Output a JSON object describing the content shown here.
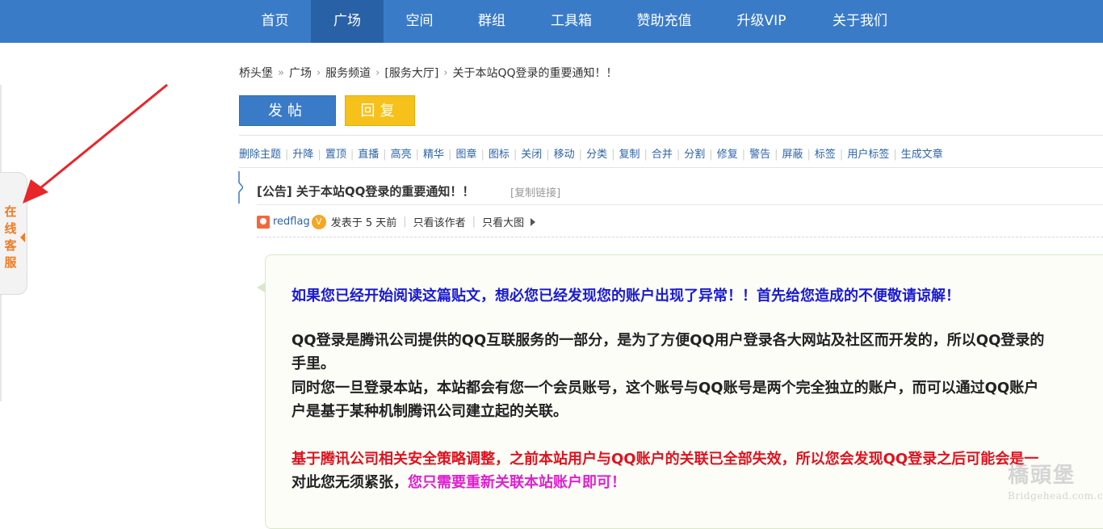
{
  "nav": {
    "items": [
      {
        "label": "首页"
      },
      {
        "label": "广场"
      },
      {
        "label": "空间"
      },
      {
        "label": "群组"
      },
      {
        "label": "工具箱"
      },
      {
        "label": "赞助充值"
      },
      {
        "label": "升级VIP"
      },
      {
        "label": "关于我们"
      }
    ],
    "active": "广场"
  },
  "side": {
    "service_label": "在线客服"
  },
  "breadcrumb": {
    "items": [
      "桥头堡",
      "广场",
      "服务频道",
      "[服务大厅]",
      "关于本站QQ登录的重要通知！！"
    ],
    "separators": [
      "»",
      "›",
      "›",
      "›"
    ]
  },
  "actions": {
    "post": "发帖",
    "reply": "回复"
  },
  "admin_tools": [
    "删除主题",
    "升降",
    "置顶",
    "直播",
    "高亮",
    "精华",
    "图章",
    "图标",
    "关闭",
    "移动",
    "分类",
    "复制",
    "合并",
    "分割",
    "修复",
    "警告",
    "屏蔽",
    "标签",
    "用户标签",
    "生成文章"
  ],
  "thread": {
    "title": "[公告] 关于本站QQ登录的重要通知！！",
    "copy_link": "[复制链接]",
    "author": "redflag",
    "vip_badge": "V",
    "posted": "发表于 5 天前",
    "only_author": "只看该作者",
    "only_images": "只看大图"
  },
  "content": {
    "line1": "如果您已经开始阅读这篇贴文，想必您已经发现您的账户出现了异常！！首先给您造成的不便敬请谅解！",
    "line2": "QQ登录是腾讯公司提供的QQ互联服务的一部分，是为了方便QQ用户登录各大网站及社区而开发的，所以QQ登录的",
    "line3": "手里。",
    "line4": "同时您一旦登录本站，本站都会有您一个会员账号，这个账号与QQ账号是两个完全独立的账户，而可以通过QQ账户",
    "line5": "户是基于某种机制腾讯公司建立起的关联。",
    "line6": "基于腾讯公司相关安全策略调整，之前本站用户与QQ账户的关联已全部失效，所以您会发现QQ登录之后可能会是一",
    "line7a": "对此您无须紧张，",
    "line7b": "您只需要重新关联本站账户即可！"
  },
  "watermark": {
    "cn": "橋頭堡",
    "en": "Bridgehead.com.cn"
  },
  "colors": {
    "nav_bg": "#3a7bc8",
    "nav_active": "#2961a6",
    "reply_btn": "#f7c11b",
    "link": "#2e64a8",
    "text_blue": "#1a1ad4",
    "text_red": "#e0121f",
    "text_magenta": "#e01fd1",
    "service_orange": "#f07b24"
  }
}
